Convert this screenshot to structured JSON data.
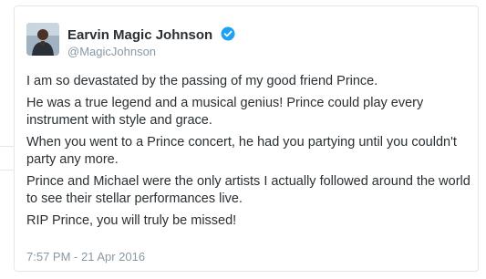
{
  "tweet": {
    "author_name": "Earvin Magic Johnson",
    "author_handle": "@MagicJohnson",
    "verified_icon": "verified-badge-icon",
    "avatar_icon": "profile-photo",
    "paragraphs": [
      "I am so devastated by the passing of my good friend Prince.",
      "He was a true legend and a musical genius! Prince could play every instrument with style and grace.",
      "When you went to a Prince concert, he had you partying until you couldn't party any more.",
      "Prince and Michael were the only artists I actually followed around the world to see their stellar performances live.",
      "RIP Prince, you will truly be missed!"
    ],
    "timestamp": "7:57 PM - 21 Apr 2016"
  },
  "colors": {
    "text": "#292f33",
    "muted": "#8899a6",
    "verified": "#1da1f2",
    "border": "#e1e8ed"
  }
}
